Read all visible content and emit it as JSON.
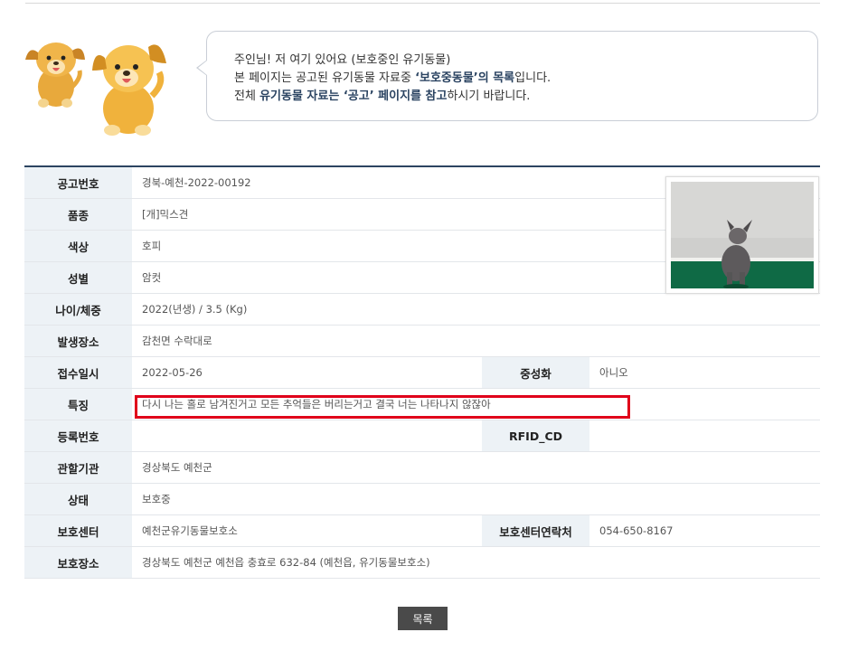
{
  "intro": {
    "line1": "주인님! 저 여기 있어요 (보호중인 유기동물)",
    "line2_a": "본 페이지는 공고된 유기동물 자료중 ",
    "line2_b": "‘보호중동물’의 목록",
    "line2_c": "입니다.",
    "line3_a": "전체 ",
    "line3_b": "유기동물 자료는 ‘공고’ 페이지를 참고",
    "line3_c": "하시기 바랍니다."
  },
  "record": {
    "notice_no": {
      "label": "공고번호",
      "value": "경북-예천-2022-00192"
    },
    "breed": {
      "label": "품종",
      "value": "[개]믹스견"
    },
    "color": {
      "label": "색상",
      "value": "호피"
    },
    "sex": {
      "label": "성별",
      "value": "암컷"
    },
    "age_weight": {
      "label": "나이/체중",
      "value": "2022(년생) / 3.5 (Kg)"
    },
    "found_place": {
      "label": "발생장소",
      "value": "감천면 수락대로"
    },
    "received_date": {
      "label": "접수일시",
      "value": "2022-05-26"
    },
    "neutered": {
      "label": "중성화",
      "value": "아니오"
    },
    "features": {
      "label": "특징",
      "value": "다시 나는 홀로 남겨진거고 모든 추억들은 버리는거고 결국 너는 나타나지 않잖아"
    },
    "reg_no": {
      "label": "등록번호",
      "value": ""
    },
    "rfid": {
      "label": "RFID_CD",
      "value": ""
    },
    "authority": {
      "label": "관할기관",
      "value": "경상북도 예천군"
    },
    "status": {
      "label": "상태",
      "value": "보호중"
    },
    "shelter": {
      "label": "보호센터",
      "value": "예천군유기동물보호소"
    },
    "shelter_phone": {
      "label": "보호센터연락처",
      "value": "054-650-8167"
    },
    "shelter_address": {
      "label": "보호장소",
      "value": "경상북도 예천군 예천읍 충효로 632-84 (예천읍, 유기동물보호소)"
    }
  },
  "buttons": {
    "list_label": "목록"
  },
  "colors": {
    "header_bg": "#edf2f6",
    "accent": "#2c4461",
    "highlight": "#e0001a"
  }
}
